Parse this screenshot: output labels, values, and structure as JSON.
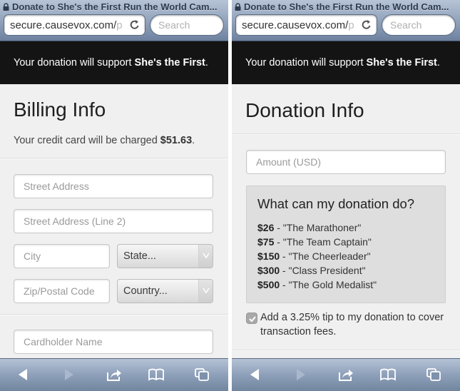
{
  "screens": [
    {
      "browser": {
        "page_title": "Donate to She's the First Run the World Cam...",
        "url_visible": "secure.causevox.com/",
        "url_faded": "p",
        "search_placeholder": "Search"
      },
      "banner": {
        "prefix": "Your donation will support ",
        "org": "She's the First",
        "suffix": "."
      },
      "section": {
        "title": "Billing Info",
        "charge_prefix": "Your credit card will be charged ",
        "charge_amount": "$51.63",
        "charge_suffix": "."
      },
      "fields": {
        "street": "Street Address",
        "street2": "Street Address (Line 2)",
        "city": "City",
        "state": "State...",
        "zip": "Zip/Postal Code",
        "country": "Country...",
        "cardholder": "Cardholder Name"
      }
    },
    {
      "browser": {
        "page_title": "Donate to She's the First Run the World Cam...",
        "url_visible": "secure.causevox.com/",
        "url_faded": "p",
        "search_placeholder": "Search"
      },
      "banner": {
        "prefix": "Your donation will support ",
        "org": "She's the First",
        "suffix": "."
      },
      "section": {
        "title": "Donation Info"
      },
      "fields": {
        "amount": "Amount (USD)"
      },
      "info_box": {
        "title": "What can my donation do?",
        "tiers": [
          {
            "amount": "$26",
            "name": " - \"The Marathoner\""
          },
          {
            "amount": "$75",
            "name": " - \"The Team Captain\""
          },
          {
            "amount": "$150",
            "name": " - \"The Cheerleader\""
          },
          {
            "amount": "$300",
            "name": " - \"Class President\""
          },
          {
            "amount": "$500",
            "name": " - \"The Gold Medalist\""
          }
        ]
      },
      "tip": {
        "checked": true,
        "label": "Add a 3.25% tip to my donation to cover transaction fees."
      }
    }
  ],
  "toolbar": {
    "icons": [
      "back-icon",
      "forward-icon",
      "share-icon",
      "bookmarks-icon",
      "tabs-icon"
    ]
  }
}
